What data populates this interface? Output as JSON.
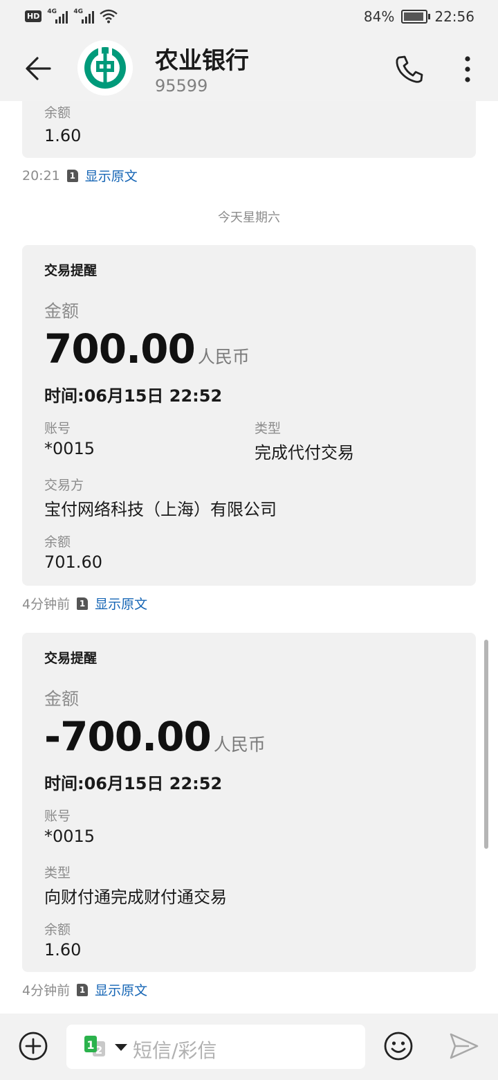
{
  "status_bar": {
    "hd": "HD",
    "net1": "4G",
    "net2": "4G",
    "battery_pct": "84%",
    "time": "22:56"
  },
  "header": {
    "title": "农业银行",
    "subtitle": "95599",
    "brand_color": "#009a7a"
  },
  "messages": {
    "prev": {
      "balance_label": "余额",
      "balance_value": "1.60",
      "time": "20:21",
      "sim": "1",
      "show_original": "显示原文"
    },
    "date_separator": "今天星期六",
    "msg1": {
      "title": "交易提醒",
      "amount_label": "金额",
      "amount": "700.00",
      "currency": "人民币",
      "time_line": "时间:06月15日 22:52",
      "account_label": "账号",
      "account_value": "*0015",
      "type_label": "类型",
      "type_value": "完成代付交易",
      "counterparty_label": "交易方",
      "counterparty_value": "宝付网络科技（上海）有限公司",
      "balance_label": "余额",
      "balance_value": "701.60",
      "time": "4分钟前",
      "sim": "1",
      "show_original": "显示原文"
    },
    "msg2": {
      "title": "交易提醒",
      "amount_label": "金额",
      "amount": "-700.00",
      "currency": "人民币",
      "time_line": "时间:06月15日 22:52",
      "account_label": "账号",
      "account_value": "*0015",
      "type_label": "类型",
      "type_value": "向财付通完成财付通交易",
      "balance_label": "余额",
      "balance_value": "1.60",
      "time": "4分钟前",
      "sim": "1",
      "show_original": "显示原文"
    }
  },
  "composer": {
    "placeholder": "短信/彩信",
    "sim1": "1",
    "sim2": "2",
    "sim_color": "#2bb24c"
  }
}
